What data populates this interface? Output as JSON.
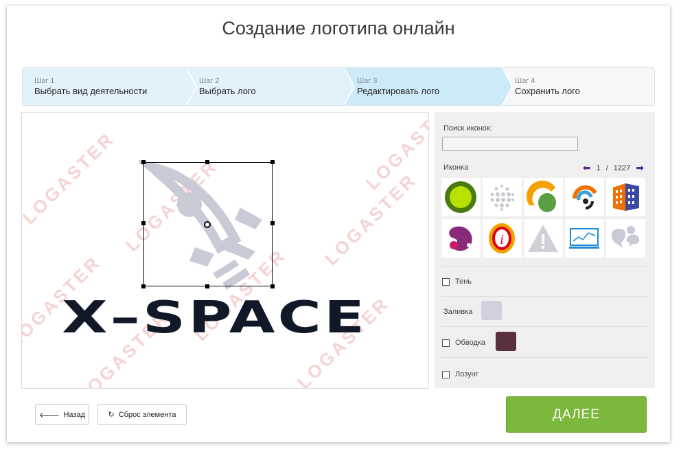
{
  "title": "Создание логотипа онлайн",
  "steps": [
    {
      "num": "Шаг 1",
      "name": "Выбрать вид деятельности"
    },
    {
      "num": "Шаг 2",
      "name": "Выбрать лого"
    },
    {
      "num": "Шаг 3",
      "name": "Редактировать лого"
    },
    {
      "num": "Шаг 4",
      "name": "Сохранить лого"
    }
  ],
  "canvas": {
    "logo_text": "X–SPACE",
    "watermark": "LOGASTER"
  },
  "panel": {
    "search_label": "Поиск иконок:",
    "search_value": "",
    "icon_label": "Иконка",
    "page_current": "1",
    "page_sep": "/",
    "page_total": "1227",
    "icons": [
      "green-circle-icon",
      "dotted-globe-icon",
      "leaf-arc-icon",
      "rss-target-icon",
      "building-icon",
      "purple-blob-icon",
      "info-icon",
      "warning-icon",
      "monitor-chart-icon",
      "speech-bubbles-icon"
    ],
    "shadow_label": "Тень",
    "fill_label": "Заливка",
    "fill_color": "#d0d0dc",
    "stroke_label": "Обводка",
    "stroke_color": "#5a3040",
    "slogan_label": "Лозунг"
  },
  "buttons": {
    "back": "Назад",
    "reset": "Сброс элемента",
    "next": "ДАЛЕЕ"
  },
  "colors": {
    "accent_green": "#7bb83c",
    "step_active": "#cdeaf9",
    "logo_icon": "#c8cad6",
    "logo_text": "#111828"
  }
}
